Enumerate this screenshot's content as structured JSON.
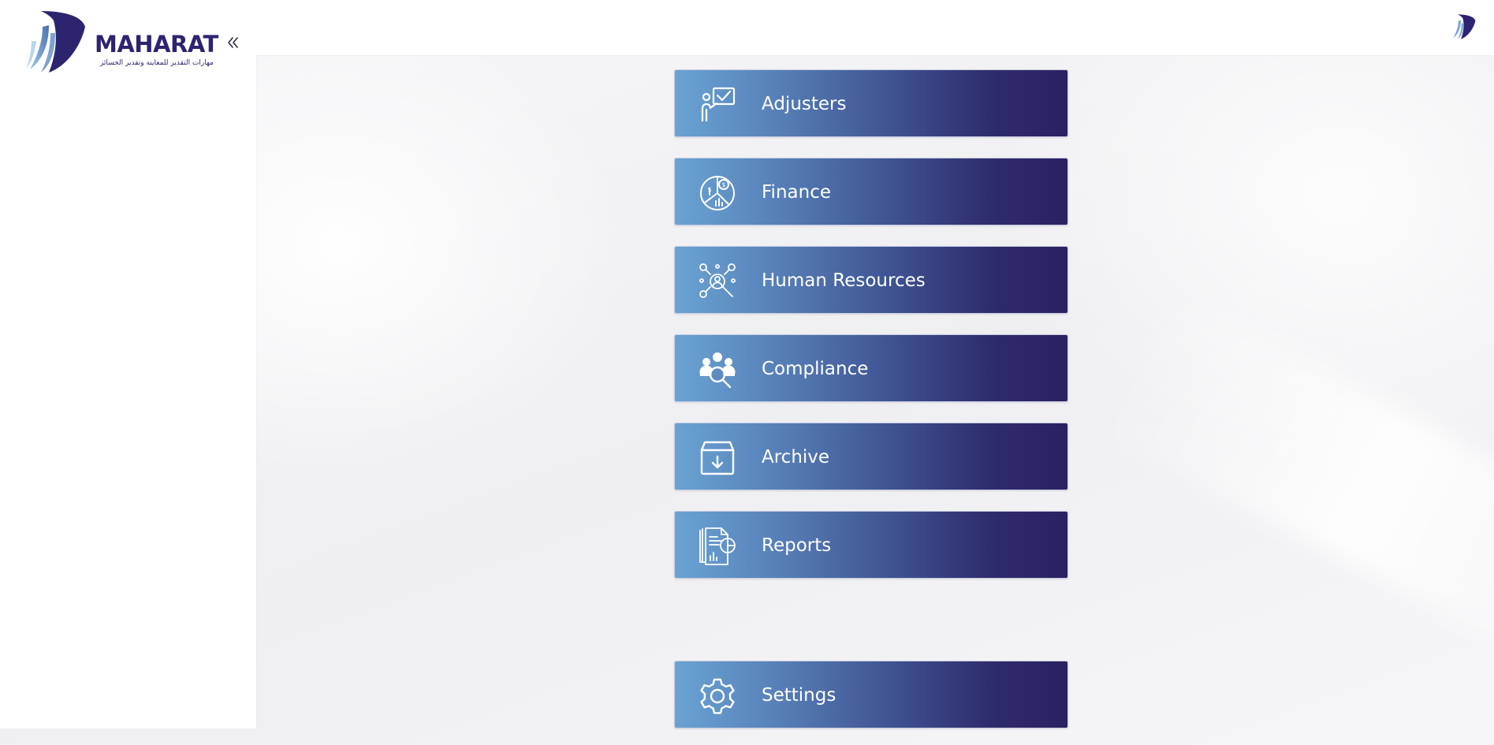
{
  "brand": {
    "name": "MAHARAT",
    "tagline": "مهارات التقدير للمعاينه وتقدير الخسائر",
    "primary_color": "#2d2470",
    "accent_color": "#6aa3d2"
  },
  "sidebar": {
    "collapse_icon": "chevrons-left-icon"
  },
  "topbar": {
    "logo_icon": "maharat-mark-icon"
  },
  "menu": {
    "items": [
      {
        "label": "Adjusters",
        "icon": "presenter-checkmark-icon"
      },
      {
        "label": "Finance",
        "icon": "finance-pie-icon"
      },
      {
        "label": "Human Resources",
        "icon": "people-search-icon"
      },
      {
        "label": "Compliance",
        "icon": "team-magnifier-icon"
      },
      {
        "label": "Archive",
        "icon": "archive-box-icon"
      },
      {
        "label": "Reports",
        "icon": "report-documents-icon"
      }
    ],
    "settings": {
      "label": "Settings",
      "icon": "gear-icon"
    }
  }
}
